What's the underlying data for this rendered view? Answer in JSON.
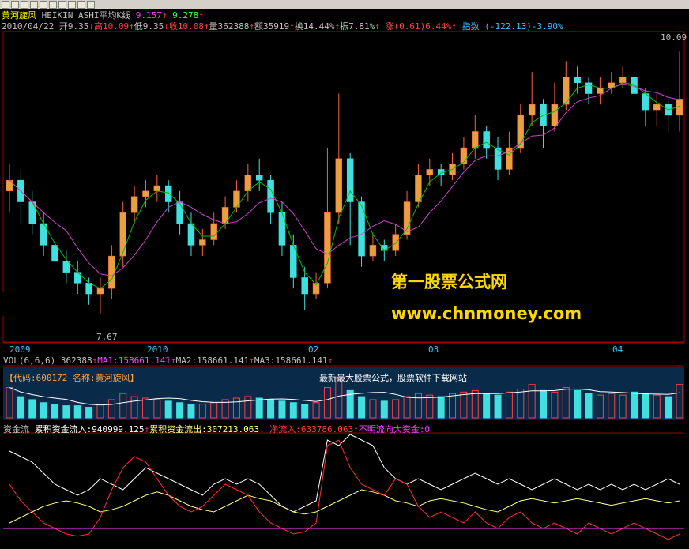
{
  "header": {
    "name": "黄河旋风",
    "indicator": "HEIKIN ASHI平均K线",
    "v1": "9.157",
    "v2": "9.278"
  },
  "quote": {
    "date": "2010/04/22",
    "open": "开9.35",
    "high": "高10.09",
    "low": "低9.35",
    "close": "收10.08",
    "volume": "量362388",
    "amount": "额35919",
    "turnover": "换14.44%",
    "amplitude": "振7.81%",
    "change_label": "涨",
    "change_val": "(0.61)",
    "change_pct": "6.44%",
    "index_label": "指数",
    "index_val": "(-122.13)-3.90%"
  },
  "price_axis": {
    "top_value": "10.09",
    "low_mark": "7.67"
  },
  "date_axis": [
    "2009",
    "2010",
    "02",
    "03",
    "04"
  ],
  "vol_header": {
    "label": "VOL(6,6,6)",
    "vol": "362388",
    "ma1": "MA1:158661.141",
    "ma2": "MA2:158661.141",
    "ma3": "MA3:158661.141"
  },
  "code_line": {
    "code": "【代码:600172 名称:黄河旋风】",
    "slogan": "最新最大股票公式，股票软件下载网站"
  },
  "flow_header": {
    "label": "资金流",
    "inflow": "累积资金流入:940999.125",
    "outflow": "累积资金流出:307213.063",
    "net": "净流入:633786.063",
    "unknown": "不明流向大资金:0"
  },
  "watermark": {
    "cn": "第一股票公式网",
    "url": "www.chnmoney.com"
  },
  "colors": {
    "up": "#e8a040",
    "down": "#40e0e0",
    "ma_fast": "#00c000",
    "ma_slow": "#d040d0",
    "white_line": "#ffffff",
    "yellow_line": "#ffff80",
    "red_line": "#ff3030",
    "magenta_line": "#ff40ff"
  },
  "chart_data": {
    "type": "candlestick",
    "ylim": [
      7.5,
      10.2
    ],
    "candles": [
      [
        8.8,
        8.9,
        9.05,
        8.6
      ],
      [
        8.9,
        8.7,
        9.0,
        8.5
      ],
      [
        8.7,
        8.5,
        8.8,
        8.4
      ],
      [
        8.5,
        8.3,
        8.6,
        8.2
      ],
      [
        8.3,
        8.15,
        8.4,
        8.05
      ],
      [
        8.15,
        8.05,
        8.25,
        7.95
      ],
      [
        8.05,
        7.95,
        8.15,
        7.85
      ],
      [
        7.95,
        7.85,
        8.0,
        7.75
      ],
      [
        7.85,
        7.9,
        8.0,
        7.67
      ],
      [
        7.9,
        8.2,
        8.3,
        7.8
      ],
      [
        8.2,
        8.6,
        8.7,
        8.1
      ],
      [
        8.6,
        8.75,
        8.85,
        8.5
      ],
      [
        8.75,
        8.8,
        8.9,
        8.65
      ],
      [
        8.8,
        8.85,
        8.95,
        8.7
      ],
      [
        8.85,
        8.7,
        8.9,
        8.6
      ],
      [
        8.7,
        8.5,
        8.8,
        8.4
      ],
      [
        8.5,
        8.3,
        8.6,
        8.2
      ],
      [
        8.3,
        8.35,
        8.45,
        8.2
      ],
      [
        8.35,
        8.5,
        8.6,
        8.3
      ],
      [
        8.5,
        8.65,
        8.75,
        8.45
      ],
      [
        8.65,
        8.8,
        8.9,
        8.6
      ],
      [
        8.8,
        8.95,
        9.05,
        8.7
      ],
      [
        8.95,
        8.9,
        9.1,
        8.8
      ],
      [
        8.9,
        8.6,
        8.95,
        8.5
      ],
      [
        8.6,
        8.3,
        8.7,
        8.2
      ],
      [
        8.3,
        8.0,
        8.4,
        7.9
      ],
      [
        8.0,
        7.85,
        8.1,
        7.7
      ],
      [
        7.85,
        7.95,
        8.05,
        7.8
      ],
      [
        7.95,
        8.6,
        9.2,
        7.9
      ],
      [
        8.6,
        9.1,
        9.7,
        8.5
      ],
      [
        9.1,
        8.7,
        9.15,
        8.3
      ],
      [
        8.7,
        8.2,
        8.75,
        8.1
      ],
      [
        8.2,
        8.3,
        8.4,
        8.15
      ],
      [
        8.3,
        8.25,
        8.35,
        8.15
      ],
      [
        8.25,
        8.4,
        8.5,
        8.2
      ],
      [
        8.4,
        8.7,
        8.8,
        8.35
      ],
      [
        8.7,
        8.95,
        9.05,
        8.65
      ],
      [
        8.95,
        9.0,
        9.1,
        8.85
      ],
      [
        9.0,
        8.95,
        9.05,
        8.85
      ],
      [
        8.95,
        9.05,
        9.15,
        8.9
      ],
      [
        9.05,
        9.2,
        9.3,
        9.0
      ],
      [
        9.2,
        9.35,
        9.5,
        9.1
      ],
      [
        9.35,
        9.2,
        9.4,
        9.1
      ],
      [
        9.2,
        9.0,
        9.3,
        8.9
      ],
      [
        9.0,
        9.2,
        9.35,
        8.95
      ],
      [
        9.2,
        9.5,
        9.6,
        9.15
      ],
      [
        9.5,
        9.6,
        9.9,
        9.4
      ],
      [
        9.6,
        9.4,
        9.65,
        9.2
      ],
      [
        9.4,
        9.6,
        9.8,
        9.35
      ],
      [
        9.6,
        9.85,
        10.0,
        9.55
      ],
      [
        9.85,
        9.8,
        9.95,
        9.7
      ],
      [
        9.8,
        9.7,
        9.85,
        9.6
      ],
      [
        9.7,
        9.75,
        9.85,
        9.6
      ],
      [
        9.75,
        9.8,
        9.9,
        9.7
      ],
      [
        9.8,
        9.85,
        9.95,
        9.75
      ],
      [
        9.85,
        9.7,
        9.9,
        9.4
      ],
      [
        9.7,
        9.55,
        9.75,
        9.4
      ],
      [
        9.55,
        9.6,
        9.7,
        9.4
      ],
      [
        9.6,
        9.5,
        9.65,
        9.35
      ],
      [
        9.5,
        9.65,
        10.09,
        9.35
      ]
    ],
    "volume": [
      20,
      14,
      12,
      10,
      9,
      8,
      8,
      7,
      9,
      12,
      16,
      14,
      13,
      12,
      11,
      10,
      9,
      9,
      10,
      12,
      13,
      14,
      13,
      12,
      11,
      10,
      9,
      10,
      20,
      26,
      18,
      14,
      12,
      11,
      12,
      14,
      16,
      15,
      14,
      16,
      17,
      18,
      16,
      15,
      17,
      19,
      22,
      18,
      17,
      20,
      18,
      16,
      15,
      16,
      15,
      17,
      16,
      15,
      14,
      22
    ],
    "net_flow_red": [
      0.55,
      0.4,
      0.3,
      0.2,
      0.15,
      0.1,
      0.08,
      0.1,
      0.25,
      0.5,
      0.7,
      0.8,
      0.75,
      0.6,
      0.45,
      0.35,
      0.3,
      0.35,
      0.45,
      0.55,
      0.5,
      0.45,
      0.3,
      0.2,
      0.15,
      0.1,
      0.12,
      0.2,
      0.9,
      0.95,
      0.7,
      0.55,
      0.5,
      0.45,
      0.6,
      0.55,
      0.35,
      0.25,
      0.3,
      0.25,
      0.2,
      0.3,
      0.2,
      0.15,
      0.25,
      0.3,
      0.2,
      0.15,
      0.2,
      0.15,
      0.1,
      0.2,
      0.15,
      0.1,
      0.15,
      0.2,
      0.15,
      0.1,
      0.05,
      0.1
    ],
    "flow_white": [
      0.85,
      0.8,
      0.75,
      0.65,
      0.55,
      0.5,
      0.45,
      0.5,
      0.6,
      0.55,
      0.5,
      0.6,
      0.7,
      0.65,
      0.6,
      0.55,
      0.5,
      0.45,
      0.55,
      0.6,
      0.55,
      0.6,
      0.55,
      0.45,
      0.35,
      0.3,
      0.35,
      0.4,
      0.95,
      0.9,
      1.0,
      0.95,
      0.9,
      0.7,
      0.6,
      0.55,
      0.6,
      0.55,
      0.5,
      0.55,
      0.6,
      0.65,
      0.6,
      0.55,
      0.6,
      0.55,
      0.5,
      0.55,
      0.6,
      0.55,
      0.5,
      0.55,
      0.5,
      0.55,
      0.5,
      0.55,
      0.5,
      0.55,
      0.6,
      0.55
    ],
    "flow_yellow": [
      0.2,
      0.25,
      0.3,
      0.35,
      0.38,
      0.4,
      0.38,
      0.35,
      0.3,
      0.32,
      0.35,
      0.4,
      0.45,
      0.48,
      0.45,
      0.4,
      0.35,
      0.32,
      0.3,
      0.35,
      0.4,
      0.45,
      0.42,
      0.4,
      0.35,
      0.3,
      0.28,
      0.3,
      0.35,
      0.4,
      0.45,
      0.5,
      0.48,
      0.45,
      0.4,
      0.38,
      0.35,
      0.4,
      0.42,
      0.4,
      0.38,
      0.35,
      0.32,
      0.3,
      0.35,
      0.4,
      0.42,
      0.4,
      0.38,
      0.4,
      0.42,
      0.4,
      0.38,
      0.36,
      0.38,
      0.4,
      0.42,
      0.4,
      0.38,
      0.4
    ],
    "flow_magenta": 0.15
  }
}
